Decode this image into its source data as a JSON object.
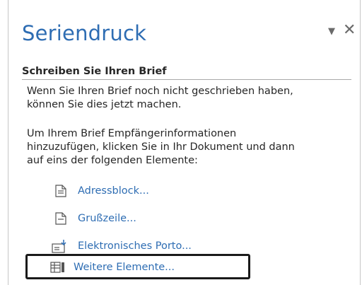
{
  "pane": {
    "title": "Seriendruck",
    "menu_icon": "dropdown-caret-icon",
    "close_icon": "close-icon"
  },
  "section": {
    "heading": "Schreiben Sie Ihren Brief",
    "para1_line1": "Wenn Sie Ihren Brief noch nicht geschrieben haben,",
    "para1_line2": "können Sie dies jetzt machen.",
    "para2_line1": "Um Ihrem Brief Empfängerinformationen",
    "para2_line2": "hinzuzufügen, klicken Sie in Ihr Dokument und dann",
    "para2_line3": "auf eins der folgenden Elemente:"
  },
  "links": [
    {
      "label": "Adressblock...",
      "icon": "address-block-icon"
    },
    {
      "label": "Grußzeile...",
      "icon": "greeting-line-icon"
    },
    {
      "label": "Elektronisches Porto...",
      "icon": "electronic-postage-icon"
    },
    {
      "label": "Weitere Elemente...",
      "icon": "more-items-icon"
    }
  ],
  "colors": {
    "accent": "#2e6db3",
    "text": "#262626",
    "highlight_border": "#1a1a1a"
  }
}
